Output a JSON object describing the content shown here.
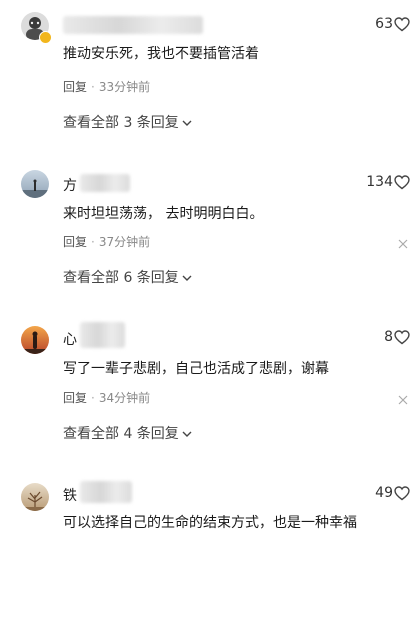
{
  "comments": [
    {
      "username_visible": "",
      "likes": "63",
      "text": "推动安乐死，我也不要插管活着",
      "reply_label": "回复",
      "time": "33分钟前",
      "view_more": "查看全部 3 条回复"
    },
    {
      "username_visible": "方",
      "likes": "134",
      "text": "来时坦坦荡荡， 去时明明白白。",
      "reply_label": "回复",
      "time": "37分钟前",
      "view_more": "查看全部 6 条回复"
    },
    {
      "username_visible": "心",
      "likes": "8",
      "text": "写了一辈子悲剧，自己也活成了悲剧，谢幕",
      "reply_label": "回复",
      "time": "34分钟前",
      "view_more": "查看全部 4 条回复"
    },
    {
      "username_visible": "铁",
      "likes": "49",
      "text": "可以选择自己的生命的结束方式，也是一种幸福",
      "reply_label": "",
      "time": "",
      "view_more": ""
    }
  ],
  "icons": {
    "like": "heart-outline-icon",
    "more": "close-icon",
    "expand": "chevron-down-icon"
  },
  "colors": {
    "badge": "#f2b61c",
    "meta_text": "#888888"
  }
}
